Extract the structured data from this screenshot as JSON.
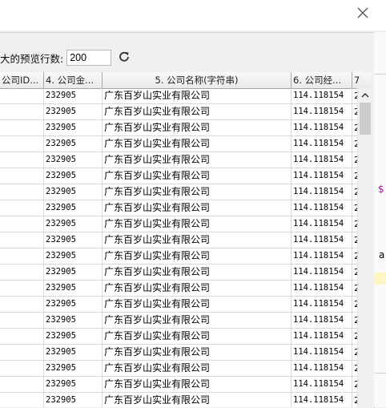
{
  "dialog": {
    "close_icon": "close-icon",
    "max_preview_label": "大的预览行数:",
    "max_preview_value": "200",
    "refresh_icon": "refresh-icon"
  },
  "table": {
    "columns": [
      "公司ID...",
      "4. 公司金...",
      "5. 公司名称(字符串)",
      "6. 公司经...",
      "7"
    ],
    "row_count_visible": 20,
    "row": {
      "c1": "",
      "c2": "232905",
      "c3": "广东百岁山实业有限公司",
      "c4": "114.118154",
      "c5": "2"
    }
  },
  "right_strip": {
    "dollar": "$",
    "letter": "a"
  },
  "colors": {
    "header_bg": "#efefef",
    "grid_line": "#d8d8d8",
    "accent_magenta": "#c000c0"
  }
}
